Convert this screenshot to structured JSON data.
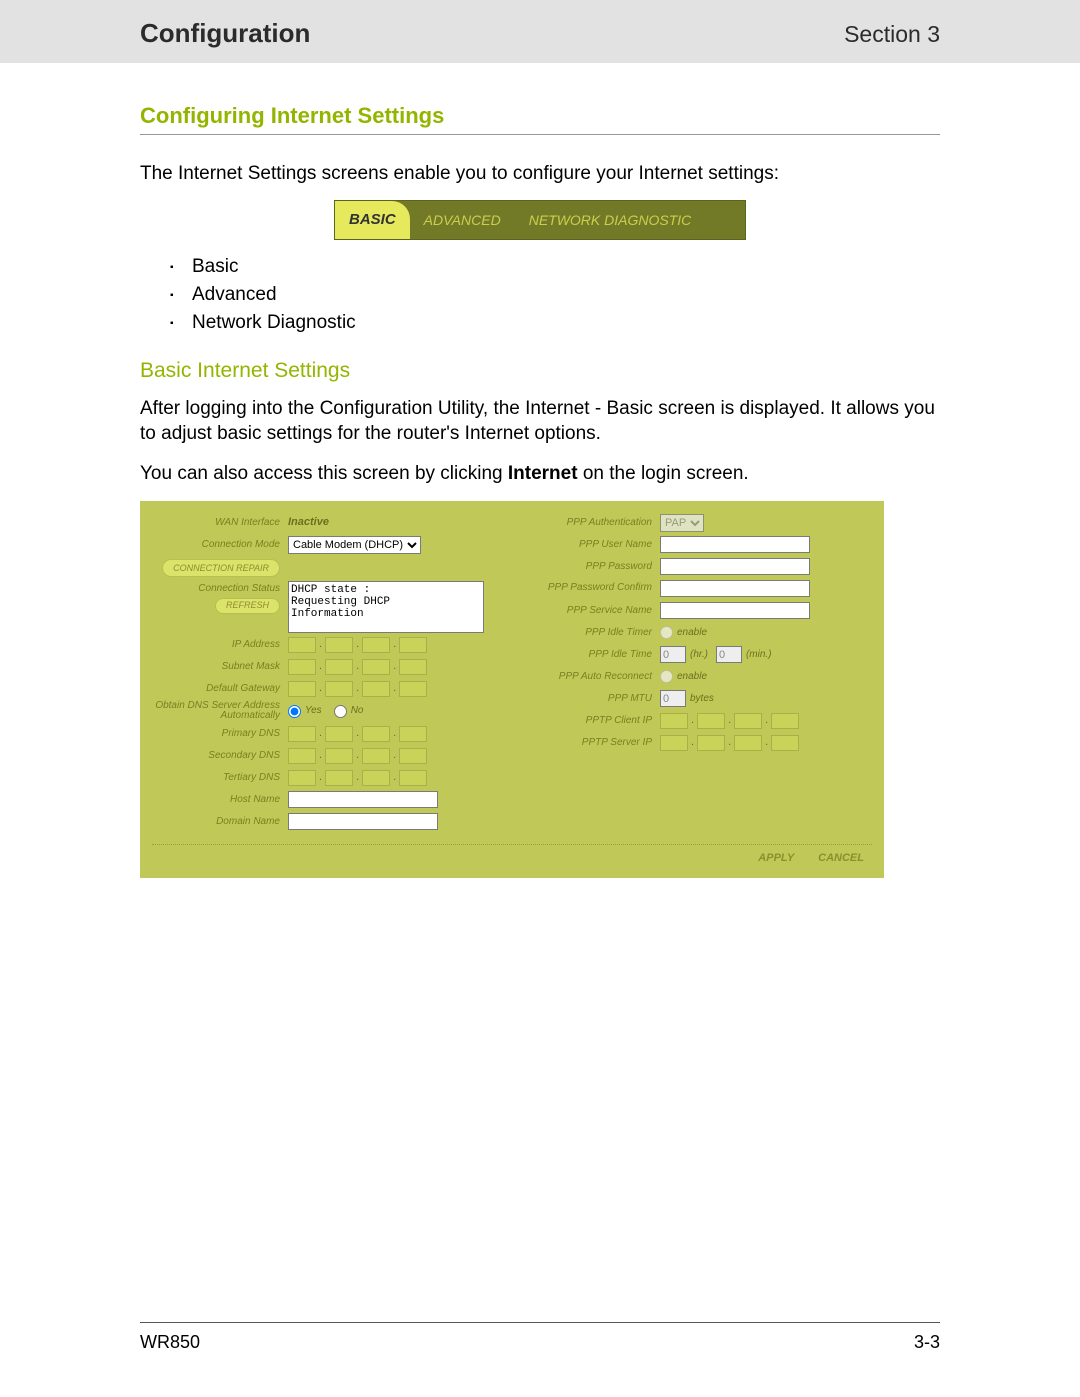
{
  "header": {
    "title": "Configuration",
    "section": "Section 3"
  },
  "headings": {
    "h2": "Configuring Internet Settings",
    "intro": "The Internet Settings screens enable you to configure your Internet settings:",
    "h3": "Basic Internet Settings",
    "p1": "After logging into the Configuration Utility, the Internet - Basic screen is displayed. It allows you to adjust basic settings for the router's Internet options.",
    "p2_a": "You can also access this screen by clicking ",
    "p2_b": "Internet",
    "p2_c": " on the login screen."
  },
  "tabs": {
    "basic": "BASIC",
    "advanced": "ADVANCED",
    "diag": "NETWORK DIAGNOSTIC"
  },
  "bullets": [
    "Basic",
    "Advanced",
    "Network Diagnostic"
  ],
  "panel": {
    "left": {
      "wan_interface_label": "WAN Interface",
      "wan_interface_value": "Inactive",
      "connection_mode_label": "Connection Mode",
      "connection_mode_value": "Cable Modem (DHCP)",
      "connection_repair": "CONNECTION REPAIR",
      "connection_status_label": "Connection Status",
      "connection_status_value": "DHCP state :\nRequesting DHCP\nInformation",
      "refresh": "REFRESH",
      "ip_address": "IP Address",
      "subnet_mask": "Subnet Mask",
      "default_gateway": "Default Gateway",
      "obtain_dns": "Obtain DNS Server Address Automatically",
      "obtain_dns_yes": "Yes",
      "obtain_dns_no": "No",
      "primary_dns": "Primary DNS",
      "secondary_dns": "Secondary DNS",
      "tertiary_dns": "Tertiary DNS",
      "host_name": "Host Name",
      "domain_name": "Domain Name"
    },
    "right": {
      "ppp_auth_label": "PPP Authentication",
      "ppp_auth_value": "PAP",
      "ppp_user": "PPP User Name",
      "ppp_pass": "PPP Password",
      "ppp_pass_confirm": "PPP Password Confirm",
      "ppp_service": "PPP Service Name",
      "ppp_idle_timer": "PPP Idle Timer",
      "enable": "enable",
      "ppp_idle_time": "PPP Idle Time",
      "idle_hr": "0",
      "idle_min": "0",
      "hr_unit": "(hr.)",
      "min_unit": "(min.)",
      "ppp_auto_reconnect": "PPP Auto Reconnect",
      "ppp_mtu": "PPP MTU",
      "mtu_val": "0",
      "bytes": "bytes",
      "pptp_client": "PPTP Client IP",
      "pptp_server": "PPTP Server IP"
    },
    "footer": {
      "apply": "APPLY",
      "cancel": "CANCEL"
    }
  },
  "footer": {
    "model": "WR850",
    "page": "3-3"
  }
}
